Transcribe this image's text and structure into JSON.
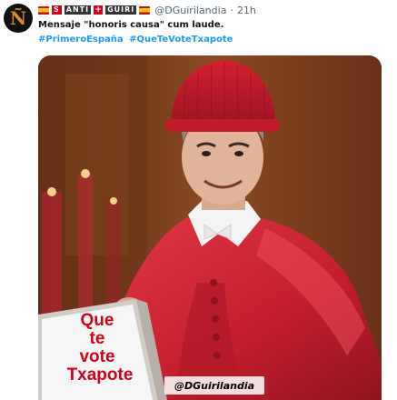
{
  "tweet": {
    "avatar_letter": "Ñ",
    "display_name_parts": [
      "S",
      "ANTI",
      "+",
      "GUIRI"
    ],
    "handle": "@DGuirilandia",
    "separator": "·",
    "time": "21h",
    "text": "Mensaje \"honoris causa\" cum laude.",
    "hashtags": [
      "#PrimeroEspaña",
      "#QueTeVoteTxapote"
    ]
  },
  "media": {
    "sign_lines": [
      "Que",
      "te",
      "vote",
      "Txapote"
    ],
    "watermark": "@DGuirilandia"
  },
  "colors": {
    "link": "#1d9bf0",
    "sign_text": "#d0021b",
    "robe": "#c8202e"
  }
}
